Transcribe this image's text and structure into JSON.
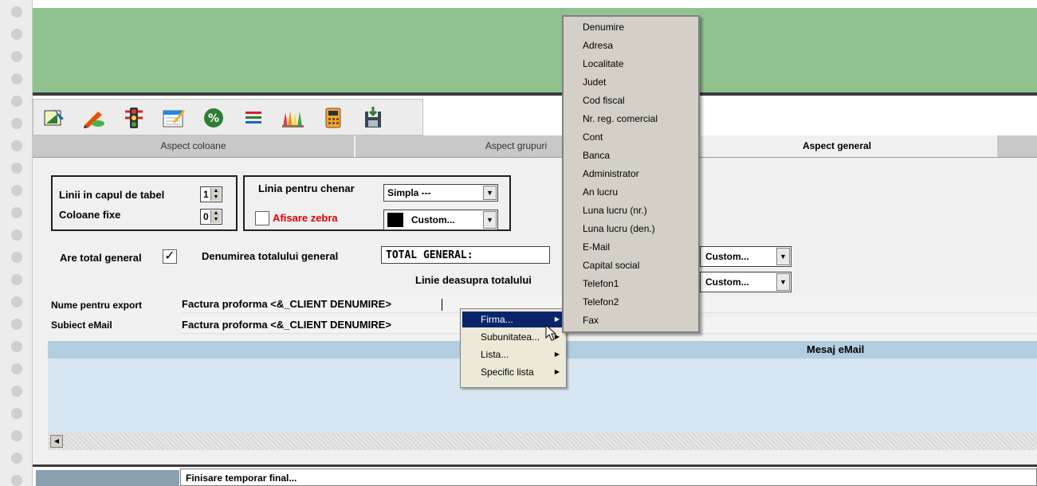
{
  "toolbar": {
    "icons": [
      "design-icon",
      "edit-pen-icon",
      "traffic-light-icon",
      "calendar-edit-icon",
      "percent-icon",
      "lines-icon",
      "crayons-icon",
      "calculator-icon",
      "save-export-icon"
    ]
  },
  "tabs": [
    {
      "label": "Aspect coloane"
    },
    {
      "label": "Aspect grupuri"
    },
    {
      "label": "Aspect general"
    }
  ],
  "form": {
    "header_rows_label": "Linii in capul de tabel",
    "header_rows_value": "1",
    "fixed_columns_label": "Coloane fixe",
    "fixed_columns_value": "0",
    "border_line_label": "Linia pentru chenar",
    "border_line_value": "Simpla   ---",
    "zebra_label": "Afisare zebra",
    "zebra_color_value": "Custom...",
    "total_label": "Are total general",
    "total_name_label": "Denumirea totalului general",
    "total_name_value": "TOTAL GENERAL:",
    "total_color_value": "Custom...",
    "line_above_label": "Linie deasupra totalului",
    "line_above_value": "Custom...",
    "export_name_label": "Nume pentru export",
    "export_name_value": "Factura proforma <&_CLIENT DENUMIRE>",
    "email_subject_label": "Subiect eMail",
    "email_subject_value": "Factura proforma <&_CLIENT DENUMIRE>",
    "email_message_label": "Mesaj eMail"
  },
  "context_menu": {
    "items": [
      {
        "label": "Firma..."
      },
      {
        "label": "Subunitatea..."
      },
      {
        "label": "Lista..."
      },
      {
        "label": "Specific lista"
      }
    ]
  },
  "submenu": {
    "items": [
      "Denumire",
      "Adresa",
      "Localitate",
      "Judet",
      "Cod fiscal",
      "Nr. reg. comercial",
      "Cont",
      "Banca",
      "Administrator",
      "An lucru",
      "Luna lucru (nr.)",
      "Luna lucru (den.)",
      "E-Mail",
      "Capital social",
      "Telefon1",
      "Telefon2",
      "Fax"
    ]
  },
  "status": {
    "text": "Finisare temporar final..."
  },
  "colors": {
    "header_green": "#90c290",
    "menu_highlight": "#0a246a",
    "zebra_label": "#e00000",
    "mail_header": "#b3cde0"
  }
}
